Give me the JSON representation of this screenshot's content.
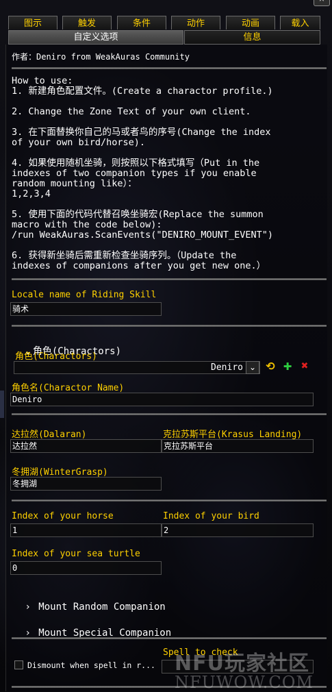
{
  "window": {
    "close_label": "×"
  },
  "tabs": [
    {
      "label": "图示"
    },
    {
      "label": "触发"
    },
    {
      "label": "条件"
    },
    {
      "label": "动作"
    },
    {
      "label": "动画"
    },
    {
      "label": "载入"
    }
  ],
  "subtabs": [
    {
      "label": "自定义选项",
      "active": true
    },
    {
      "label": "信息",
      "active": false
    }
  ],
  "author": "作者：Deniro from WeakAuras Community",
  "description": [
    "How to use:",
    "1. 新建角色配置文件。(Create a charactor profile.)",
    "",
    "2. Change the Zone Text of your own client.",
    "",
    "3. 在下面替换你自己的马或者鸟的序号(Change the index",
    "of your own bird/horse).",
    "",
    "4. 如果使用随机坐骑，则按照以下格式填写（Put in the",
    "indexes of two companion types if you enable",
    "random mounting like）：",
    "1,2,3,4",
    "",
    "5. 使用下面的代码代替召唤坐骑宏(Replace the summon",
    "macro with the code below):",
    "/run WeakAuras.ScanEvents(\"DENIRO_MOUNT_EVENT\")",
    "",
    "6. 获得新坐骑后需重新检查坐骑序列。（Update the",
    "indexes of companions after you get new one.）"
  ],
  "riding_skill": {
    "label": "Locale name of Riding Skill",
    "value": "骑术"
  },
  "characters": {
    "group_label": "角色(Charactors)",
    "expanded_icon": "chevron-down",
    "dropdown_label": "角色(Charactors)",
    "dropdown_value": "Deniro",
    "dropdown_arrow": "chevron-down",
    "reset_icon": "reset-icon",
    "add_icon": "plus-icon",
    "delete_icon": "x-icon",
    "reset_glyph": "⟲",
    "add_glyph": "✚",
    "delete_glyph": "✖",
    "add_color": "#2ecc40",
    "delete_color": "#e02020",
    "reset_color": "#f0c000"
  },
  "char_name": {
    "label": "角色名(Charactor Name)",
    "value": "Deniro"
  },
  "dalaran": {
    "label": "达拉然(Dalaran)",
    "value": "达拉然"
  },
  "krasus": {
    "label": "克拉苏斯平台(Krasus Landing)",
    "value": "克拉苏斯平台"
  },
  "wintergrasp": {
    "label": "冬拥湖(WinterGrasp)",
    "value": "冬拥湖"
  },
  "horse": {
    "label": "Index of your horse",
    "value": "1"
  },
  "bird": {
    "label": "Index of your bird",
    "value": "2"
  },
  "turtle": {
    "label": "Index of your sea turtle",
    "value": "0"
  },
  "random_companion": {
    "label": "Mount Random Companion",
    "icon": "chevron-right"
  },
  "special_companion": {
    "label": "Mount Special Companion",
    "icon": "chevron-right"
  },
  "dismount": {
    "checkbox_label": "Dismount when spell in r...",
    "checked": false
  },
  "spell_check": {
    "label": "Spell to check",
    "value": ""
  },
  "watermark": {
    "line1": "NFU玩家社区",
    "line2": "NFUWOW.COM"
  },
  "colors": {
    "accent_gold": "#ffd100",
    "text": "#ffffff"
  }
}
